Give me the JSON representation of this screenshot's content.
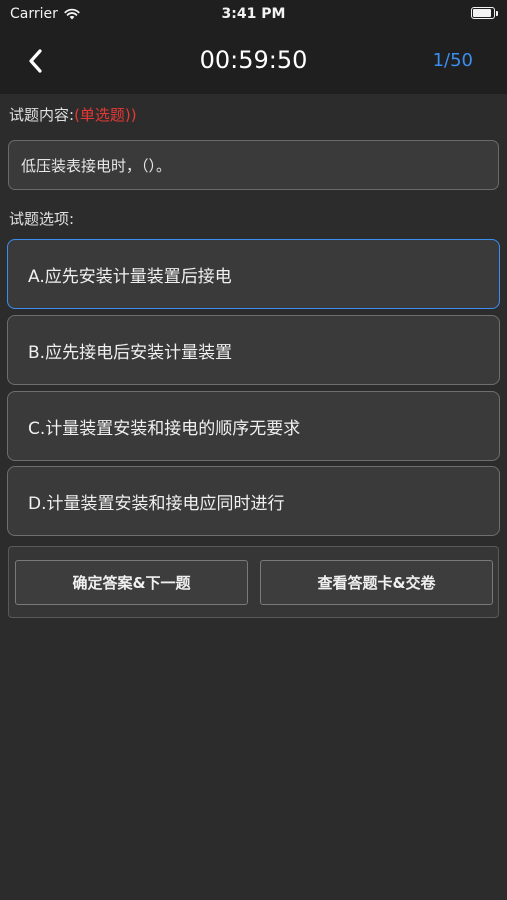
{
  "status_bar": {
    "carrier": "Carrier",
    "time": "3:41 PM",
    "battery_level": 1.0
  },
  "nav": {
    "back_icon": "chevron-left-icon",
    "timer": "00:59:50",
    "counter": "1/50",
    "counter_color": "#3a8ef0"
  },
  "question": {
    "label": "试题内容:",
    "type": "(单选题))",
    "type_color": "#e53935",
    "text": "低压装表接电时，（）。"
  },
  "options": {
    "label": "试题选项:",
    "items": [
      {
        "text": "A.应先安装计量装置后接电",
        "selected": true
      },
      {
        "text": "B.应先接电后安装计量装置",
        "selected": false
      },
      {
        "text": "C.计量装置安装和接电的顺序无要求",
        "selected": false
      },
      {
        "text": "D.计量装置安装和接电应同时进行",
        "selected": false
      }
    ]
  },
  "buttons": {
    "confirm_next": "确定答案&下一题",
    "answer_card_submit": "查看答题卡&交卷"
  },
  "colors": {
    "background": "#2c2c2c",
    "bar": "#1f1f1f",
    "accent": "#3a8ef0"
  }
}
